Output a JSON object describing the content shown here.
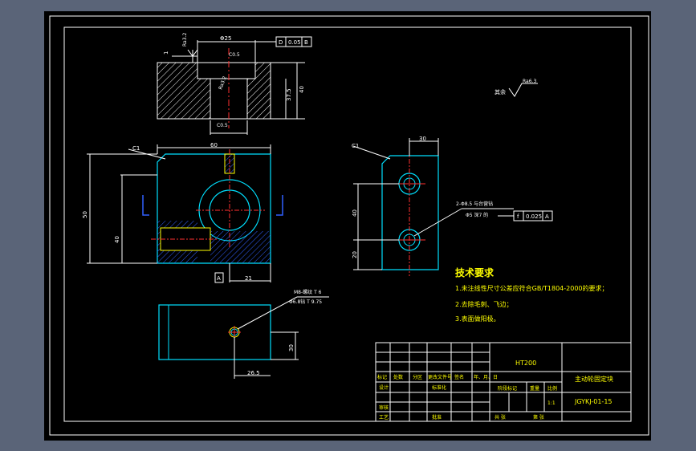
{
  "dims": {
    "top_width": "Φ25",
    "c05_a": "C0.5",
    "c05_b": "C0.5",
    "height_40": "40",
    "height_375": "37.5",
    "ra32_a": "Ra3.2",
    "ra32_b": "Ra3.2",
    "ra32_c": "Ra3.2",
    "c1_left": "C1",
    "front_width": "60",
    "front_height": "50",
    "front_40": "40",
    "front_21": "21",
    "bottom_30": "30",
    "bottom_265": "26.5",
    "side_30": "30",
    "side_40": "40",
    "side_20": "20",
    "c1_right": "C1",
    "label_1": "1",
    "label_A": "A"
  },
  "tolerance_top": {
    "symbol": "D",
    "value": "0.05",
    "ref": "B"
  },
  "tolerance_side": {
    "symbol": "f",
    "value": "0.025",
    "ref": "A"
  },
  "holes_note_1": "2-Φ8.5 与台营钻",
  "holes_note_2": "Φ5 深7 的",
  "thread_note_1": "M8-螺纹 T 6",
  "thread_note_2": "Φ6.8钻 T 9.75",
  "roughness_other": {
    "prefix": "其余",
    "value": "Ra6.3"
  },
  "requirements": {
    "title": "技术要求",
    "items": [
      "1.未注线性尺寸公差应符合GB/T1804-2000的要求；",
      "2.去除毛刺、飞边；",
      "3.表面做阳极。"
    ]
  },
  "title_block": {
    "material": "HT200",
    "part_name": "主动轮固定块",
    "drawing_no": "JGYKJ-01-15",
    "scale": "1:1",
    "hdr_mark": "标记",
    "hdr_count": "处数",
    "hdr_zone": "分区",
    "hdr_change": "更改文件号",
    "hdr_sign": "签名",
    "hdr_date": "年、月、日",
    "row_design": "设计",
    "row_standard": "标准化",
    "row_check": "审核",
    "row_process": "工艺",
    "row_approve": "批准",
    "stage_mark": "阶段标记",
    "weight": "重量",
    "scale_label": "比例",
    "sheets_total": "共 张",
    "sheet_no": "第 张"
  }
}
